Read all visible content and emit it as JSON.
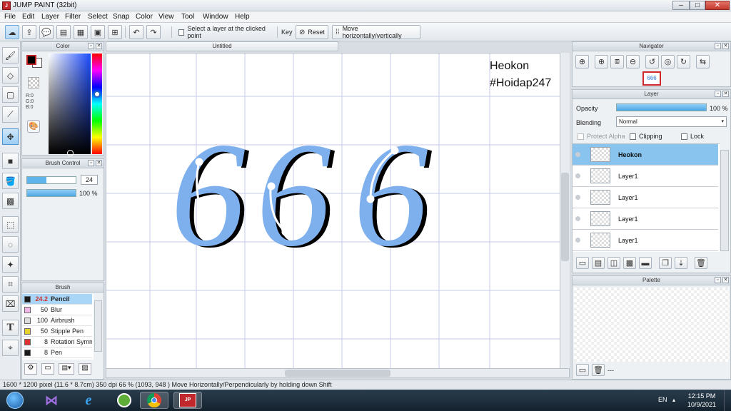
{
  "window": {
    "title": "JUMP PAINT (32bit)"
  },
  "menu": [
    "File",
    "Edit",
    "Layer",
    "Filter",
    "Select",
    "Snap",
    "Color",
    "View",
    "Tool",
    "Window",
    "Help"
  ],
  "toolbar": {
    "select_layer_label": "Select a layer at the clicked point",
    "key_label": "Key",
    "reset_label": "Reset",
    "move_label": "Move horizontally/vertically"
  },
  "color_panel": {
    "title": "Color",
    "rgb": [
      "R:0",
      "G:0",
      "B:0"
    ],
    "fg": "#000000",
    "bg": "#ffffff"
  },
  "brush_control": {
    "title": "Brush Control",
    "size": "24",
    "opacity": "100 %"
  },
  "brush_panel": {
    "title": "Brush",
    "items": [
      {
        "size": "24.2",
        "name": "Pencil",
        "color": "#1a1a1a"
      },
      {
        "size": "50",
        "name": "Blur",
        "color": "#f2b8e8"
      },
      {
        "size": "100",
        "name": "Airbrush",
        "color": "#dcdcdc"
      },
      {
        "size": "50",
        "name": "Stipple Pen",
        "color": "#e6d22a"
      },
      {
        "size": "8",
        "name": "Rotation Symm",
        "color": "#e03030"
      },
      {
        "size": "8",
        "name": "Pen",
        "color": "#1a1a1a"
      }
    ]
  },
  "canvas": {
    "tab_title": "Untitled",
    "text_line1": "Heokon",
    "text_line2": "#Hoidap247",
    "drawing_text": "666",
    "fill_color": "#7fb0ee",
    "shadow_color": "#000000"
  },
  "navigator": {
    "title": "Navigator"
  },
  "layer_panel": {
    "title": "Layer",
    "opacity_label": "Opacity",
    "opacity_value": "100 %",
    "opacity_fraction": 1.0,
    "blending_label": "Blending",
    "blending_value": "Normal",
    "protect_alpha": "Protect Alpha",
    "clipping": "Clipping",
    "lock": "Lock",
    "layers": [
      {
        "name": "Heokon",
        "selected": true
      },
      {
        "name": "Layer1"
      },
      {
        "name": "Layer1"
      },
      {
        "name": "Layer1"
      },
      {
        "name": "Layer1"
      }
    ]
  },
  "palette": {
    "title": "Palette",
    "footer": "---"
  },
  "status": {
    "text": "1600 * 1200 pixel   (11.6 * 8.7cm)  350 dpi   66 %   (1093, 948 )   Move Horizontally/Perpendicularly by holding down Shift"
  },
  "taskbar": {
    "lang": "EN",
    "time": "12:15 PM",
    "date": "10/9/2021"
  }
}
